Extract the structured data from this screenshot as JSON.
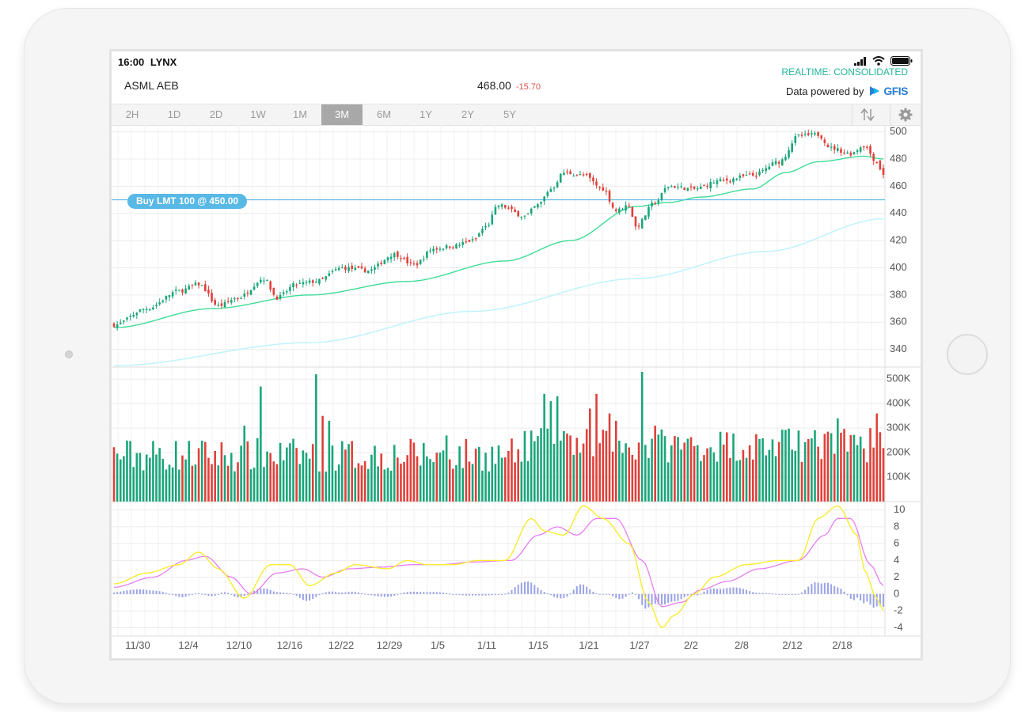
{
  "status_bar": {
    "time": "16:00",
    "carrier": "LYNX"
  },
  "header": {
    "symbol": "ASML",
    "exchange": "AEB",
    "last_price": "468.00",
    "change": "-15.70",
    "realtime_label": "REALTIME: CONSOLIDATED",
    "powered_by": "Data powered by",
    "provider": "GFIS"
  },
  "timeframes": [
    {
      "label": "2H",
      "active": false
    },
    {
      "label": "1D",
      "active": false
    },
    {
      "label": "2D",
      "active": false
    },
    {
      "label": "1W",
      "active": false
    },
    {
      "label": "1M",
      "active": false
    },
    {
      "label": "3M",
      "active": true
    },
    {
      "label": "6M",
      "active": false
    },
    {
      "label": "1Y",
      "active": false
    },
    {
      "label": "2Y",
      "active": false
    },
    {
      "label": "5Y",
      "active": false
    }
  ],
  "toolbar_icons": [
    "sort-arrows-icon",
    "gear-icon"
  ],
  "order_line": {
    "label": "Buy LMT 100 @ 450.00",
    "price": 450
  },
  "colors": {
    "up": "#1aa57a",
    "down": "#e0403a",
    "sma_fast": "#3ddc97",
    "sma_slow": "#bff3fb",
    "order": "#58b8e6",
    "macd": "#f7ec2e",
    "signal": "#e77df2",
    "histogram": "#9aa2e6",
    "realtime": "#25b59a"
  },
  "chart_data": [
    {
      "type": "candlestick",
      "title": "",
      "x_ticks": [
        "11/30",
        "12/4",
        "12/10",
        "12/16",
        "12/22",
        "12/29",
        "1/5",
        "1/11",
        "1/15",
        "1/21",
        "1/27",
        "2/2",
        "2/8",
        "2/12",
        "2/18"
      ],
      "y_ticks": [
        340,
        360,
        380,
        400,
        420,
        440,
        460,
        480,
        500
      ],
      "ylim": [
        327,
        505
      ],
      "close_anchors": [
        [
          0,
          358
        ],
        [
          10,
          370
        ],
        [
          20,
          383
        ],
        [
          26,
          388
        ],
        [
          32,
          372
        ],
        [
          38,
          378
        ],
        [
          46,
          392
        ],
        [
          50,
          378
        ],
        [
          56,
          388
        ],
        [
          62,
          390
        ],
        [
          70,
          400
        ],
        [
          78,
          398
        ],
        [
          86,
          410
        ],
        [
          92,
          402
        ],
        [
          98,
          414
        ],
        [
          104,
          416
        ],
        [
          110,
          420
        ],
        [
          114,
          430
        ],
        [
          118,
          446
        ],
        [
          126,
          438
        ],
        [
          130,
          446
        ],
        [
          134,
          458
        ],
        [
          138,
          470
        ],
        [
          144,
          468
        ],
        [
          150,
          458
        ],
        [
          154,
          442
        ],
        [
          158,
          446
        ],
        [
          160,
          430
        ],
        [
          166,
          448
        ],
        [
          170,
          460
        ],
        [
          178,
          458
        ],
        [
          186,
          464
        ],
        [
          196,
          468
        ],
        [
          204,
          478
        ],
        [
          210,
          497
        ],
        [
          216,
          498
        ],
        [
          220,
          488
        ],
        [
          226,
          484
        ],
        [
          230,
          490
        ],
        [
          234,
          478
        ],
        [
          236,
          468
        ]
      ],
      "sma_fast_anchors": [
        [
          0,
          356
        ],
        [
          30,
          370
        ],
        [
          60,
          380
        ],
        [
          90,
          390
        ],
        [
          120,
          405
        ],
        [
          140,
          420
        ],
        [
          160,
          445
        ],
        [
          170,
          448
        ],
        [
          180,
          452
        ],
        [
          196,
          458
        ],
        [
          206,
          470
        ],
        [
          216,
          478
        ],
        [
          230,
          482
        ],
        [
          236,
          480
        ]
      ],
      "sma_slow_anchors": [
        [
          0,
          328
        ],
        [
          60,
          345
        ],
        [
          110,
          368
        ],
        [
          160,
          392
        ],
        [
          200,
          412
        ],
        [
          236,
          436
        ]
      ],
      "order_price": 450,
      "volume": {
        "y_ticks": [
          "100K",
          "200K",
          "300K",
          "400K",
          "500K"
        ],
        "tick_values": [
          100000,
          200000,
          300000,
          400000,
          500000
        ],
        "ylim": [
          0,
          530000
        ],
        "spikes": [
          [
            40,
            310000
          ],
          [
            45,
            470000
          ],
          [
            62,
            520000
          ],
          [
            64,
            350000
          ],
          [
            66,
            330000
          ],
          [
            102,
            270000
          ],
          [
            128,
            290000
          ],
          [
            132,
            440000
          ],
          [
            134,
            410000
          ],
          [
            136,
            430000
          ],
          [
            140,
            270000
          ],
          [
            146,
            380000
          ],
          [
            148,
            440000
          ],
          [
            152,
            360000
          ],
          [
            154,
            330000
          ],
          [
            162,
            530000
          ],
          [
            166,
            310000
          ],
          [
            210,
            290000
          ],
          [
            222,
            340000
          ],
          [
            232,
            300000
          ],
          [
            234,
            360000
          ]
        ]
      },
      "macd": {
        "y_ticks": [
          -4,
          -2,
          0,
          2,
          4,
          6,
          8,
          10
        ],
        "ylim": [
          -5,
          11
        ],
        "macd_anchors": [
          [
            0,
            1.2
          ],
          [
            10,
            2.5
          ],
          [
            20,
            3.5
          ],
          [
            26,
            5.0
          ],
          [
            32,
            3.0
          ],
          [
            40,
            -0.5
          ],
          [
            48,
            3.5
          ],
          [
            54,
            3.5
          ],
          [
            60,
            1.0
          ],
          [
            68,
            2.5
          ],
          [
            74,
            3.5
          ],
          [
            84,
            3.0
          ],
          [
            90,
            4.0
          ],
          [
            96,
            3.5
          ],
          [
            104,
            3.5
          ],
          [
            112,
            4.0
          ],
          [
            120,
            4.0
          ],
          [
            128,
            9.0
          ],
          [
            132,
            7.5
          ],
          [
            138,
            7.0
          ],
          [
            144,
            10.5
          ],
          [
            150,
            9.0
          ],
          [
            158,
            6.0
          ],
          [
            164,
            -1.0
          ],
          [
            168,
            -4.0
          ],
          [
            172,
            -2.5
          ],
          [
            178,
            0.0
          ],
          [
            184,
            2.0
          ],
          [
            194,
            3.5
          ],
          [
            204,
            4.0
          ],
          [
            210,
            4.0
          ],
          [
            216,
            9.0
          ],
          [
            222,
            10.5
          ],
          [
            228,
            7.0
          ],
          [
            230,
            3.0
          ],
          [
            234,
            -0.5
          ],
          [
            236,
            -2.0
          ]
        ],
        "signal_anchors": [
          [
            0,
            0.8
          ],
          [
            12,
            2.0
          ],
          [
            22,
            4.0
          ],
          [
            28,
            4.5
          ],
          [
            36,
            2.0
          ],
          [
            42,
            0.0
          ],
          [
            50,
            2.5
          ],
          [
            58,
            3.0
          ],
          [
            64,
            2.0
          ],
          [
            72,
            3.0
          ],
          [
            82,
            3.2
          ],
          [
            92,
            3.5
          ],
          [
            100,
            3.5
          ],
          [
            110,
            3.8
          ],
          [
            122,
            4.0
          ],
          [
            130,
            7.0
          ],
          [
            136,
            8.0
          ],
          [
            142,
            7.0
          ],
          [
            148,
            9.0
          ],
          [
            154,
            9.0
          ],
          [
            162,
            4.0
          ],
          [
            168,
            -1.5
          ],
          [
            174,
            -1.0
          ],
          [
            180,
            0.5
          ],
          [
            188,
            1.5
          ],
          [
            198,
            3.0
          ],
          [
            210,
            4.0
          ],
          [
            218,
            7.0
          ],
          [
            222,
            9.0
          ],
          [
            226,
            9.0
          ],
          [
            232,
            3.5
          ],
          [
            236,
            1.0
          ]
        ]
      },
      "bars_count": 237
    }
  ]
}
